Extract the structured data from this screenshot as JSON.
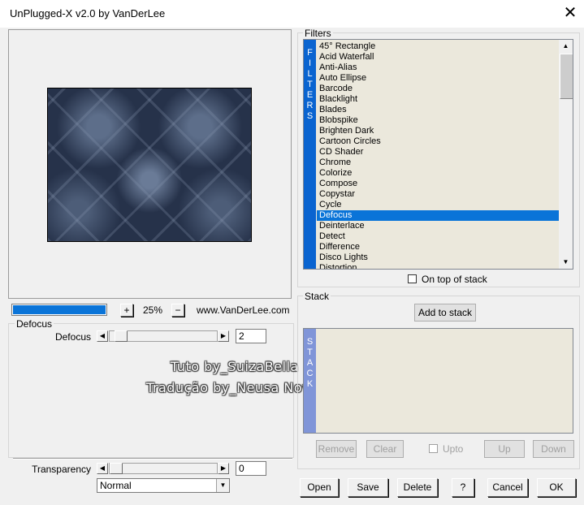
{
  "window": {
    "title": "UnPlugged-X v2.0 by VanDerLee",
    "close_glyph": "✕"
  },
  "preview": {
    "progress_fraction": 1.0,
    "zoom_in_label": "+",
    "zoom_out_label": "−",
    "zoom_value": "25%",
    "website": "www.VanDerLee.com"
  },
  "params": {
    "group_label": "Defocus",
    "defocus": {
      "label": "Defocus",
      "value": "2",
      "left_arrow": "◀",
      "right_arrow": "▶"
    },
    "transparency": {
      "label": "Transparency",
      "value": "0",
      "left_arrow": "◀",
      "right_arrow": "▶"
    },
    "blend_mode": {
      "value": "Normal",
      "arrow": "▼"
    }
  },
  "watermark": {
    "line1": "Tuto by_SuizaBella",
    "line2": "Tradução by_Neusa Novaes"
  },
  "filters": {
    "group_label": "Filters",
    "side_bar_text": [
      "F",
      "I",
      "L",
      "T",
      "E",
      "R",
      "S"
    ],
    "items": [
      "45° Rectangle",
      "Acid Waterfall",
      "Anti-Alias",
      "Auto Ellipse",
      "Barcode",
      "Blacklight",
      "Blades",
      "Blobspike",
      "Brighten Dark",
      "Cartoon Circles",
      "CD Shader",
      "Chrome",
      "Colorize",
      "Compose",
      "Copystar",
      "Cycle",
      "Defocus",
      "Deinterlace",
      "Detect",
      "Difference",
      "Disco Lights",
      "Distortion"
    ],
    "selected_index": 16,
    "scroll_up": "▲",
    "scroll_down": "▼",
    "on_top_label": "On top of stack",
    "on_top_checked": false
  },
  "stack": {
    "group_label": "Stack",
    "add_label": "Add to stack",
    "side_bar_text": [
      "S",
      "T",
      "A",
      "C",
      "K"
    ],
    "remove_label": "Remove",
    "clear_label": "Clear",
    "upto_label": "Upto",
    "up_label": "Up",
    "down_label": "Down"
  },
  "footer": {
    "open_label": "Open",
    "save_label": "Save",
    "delete_label": "Delete",
    "help_label": "?",
    "cancel_label": "Cancel",
    "ok_label": "OK"
  },
  "colors": {
    "selection": "#0a74d8",
    "list_bg": "#ebe8dc",
    "filters_bar": "#0a64d0",
    "stack_bar": "#8095d8"
  }
}
